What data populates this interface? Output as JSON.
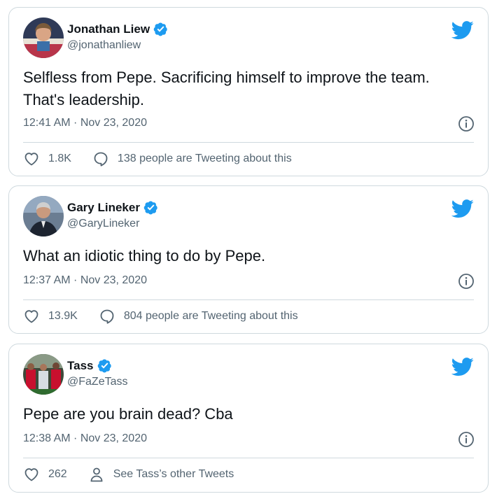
{
  "tweets": [
    {
      "name": "Jonathan Liew",
      "handle": "@jonathanliew",
      "verified": true,
      "text": "Selfless from Pepe. Sacrificing himself to improve the team. That's leadership.",
      "time": "12:41 AM · Nov 23, 2020",
      "likes": "1.8K",
      "secondary": "138 people are Tweeting about this",
      "secondary_icon": "reply-bubble-icon"
    },
    {
      "name": "Gary Lineker",
      "handle": "@GaryLineker",
      "verified": true,
      "text": "What an idiotic thing to do by Pepe.",
      "time": "12:37 AM · Nov 23, 2020",
      "likes": "13.9K",
      "secondary": "804 people are Tweeting about this",
      "secondary_icon": "reply-bubble-icon"
    },
    {
      "name": "Tass",
      "handle": "@FaZeTass",
      "verified": true,
      "text": "Pepe are you brain dead? Cba",
      "time": "12:38 AM · Nov 23, 2020",
      "likes": "262",
      "secondary": "See Tass’s other Tweets",
      "secondary_icon": "person-icon"
    }
  ],
  "colors": {
    "twitter_blue": "#1d9bf0",
    "text_primary": "#0f1419",
    "text_secondary": "#536471",
    "border": "#cfd9de"
  }
}
